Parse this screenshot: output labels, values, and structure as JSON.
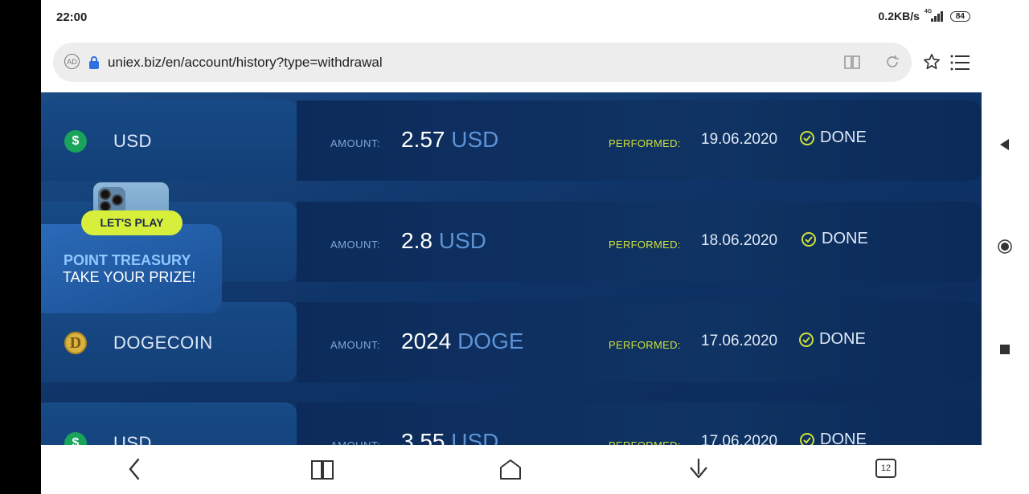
{
  "status_bar": {
    "time": "22:00",
    "speed": "0.2KB/s",
    "network": "4G",
    "battery": "84"
  },
  "browser": {
    "url": "uniex.biz/en/account/history?type=withdrawal",
    "tab_count": "12"
  },
  "history": {
    "amount_label": "AMOUNT:",
    "performed_label": "PERFORMED:",
    "rows": [
      {
        "currency": "USD",
        "coin_icon": "dollar-coin-icon",
        "amount": "2.57",
        "unit": "USD",
        "date": "19.06.2020",
        "status": "DONE"
      },
      {
        "currency": "",
        "coin_icon": "",
        "amount": "2.8",
        "unit": "USD",
        "date": "18.06.2020",
        "status": "DONE"
      },
      {
        "currency": "DOGECOIN",
        "coin_icon": "dogecoin-icon",
        "amount": "2024",
        "unit": "DOGE",
        "date": "17.06.2020",
        "status": "DONE"
      },
      {
        "currency": "USD",
        "coin_icon": "dollar-coin-icon",
        "amount": "3.55",
        "unit": "USD",
        "date": "17.06.2020",
        "status": "DONE"
      }
    ]
  },
  "promo": {
    "title": "POINT TREASURY",
    "subtitle": "TAKE YOUR PRIZE!",
    "button": "LET'S PLAY"
  },
  "colors": {
    "accent_green": "#cfe03a",
    "button_yellow": "#d7ef3a",
    "unit_blue": "#5d93d6",
    "panel_blue": "#0f3468"
  }
}
